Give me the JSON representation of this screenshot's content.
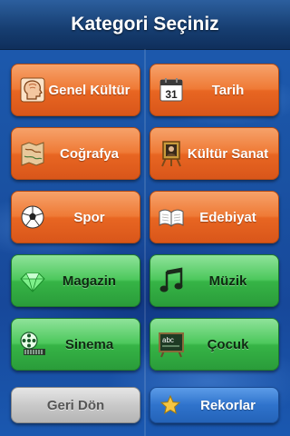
{
  "header": {
    "title": "Kategori Seçiniz"
  },
  "categories": [
    {
      "label": "Genel Kültür",
      "icon": "head-profile-icon",
      "color": "orange"
    },
    {
      "label": "Tarih",
      "icon": "calendar-icon",
      "color": "orange",
      "calendar_day": "31"
    },
    {
      "label": "Coğrafya",
      "icon": "map-icon",
      "color": "orange"
    },
    {
      "label": "Kültür Sanat",
      "icon": "easel-painting-icon",
      "color": "orange"
    },
    {
      "label": "Spor",
      "icon": "soccer-ball-icon",
      "color": "orange"
    },
    {
      "label": "Edebiyat",
      "icon": "open-book-icon",
      "color": "orange"
    },
    {
      "label": "Magazin",
      "icon": "diamond-icon",
      "color": "green"
    },
    {
      "label": "Müzik",
      "icon": "music-note-icon",
      "color": "green"
    },
    {
      "label": "Sinema",
      "icon": "film-reel-icon",
      "color": "green"
    },
    {
      "label": "Çocuk",
      "icon": "chalkboard-icon",
      "color": "green",
      "chalkboard_text": "abc"
    }
  ],
  "footer": {
    "back_label": "Geri Dön",
    "records_label": "Rekorlar",
    "records_icon": "star-icon"
  },
  "colors": {
    "orange": "#ef7a36",
    "green": "#4cc85c",
    "header": "#163d70",
    "background": "#1a52a3"
  }
}
